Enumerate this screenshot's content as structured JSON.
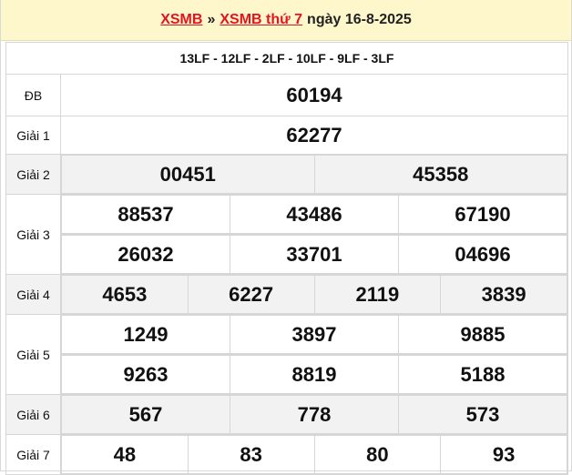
{
  "header": {
    "link1": "XSMB",
    "separator": "»",
    "link2": "XSMB thứ 7",
    "date_text": "ngày 16-8-2025"
  },
  "codes": "13LF - 12LF - 2LF - 10LF - 9LF - 3LF",
  "prizes": {
    "db": {
      "label": "ĐB",
      "values": [
        "60194"
      ]
    },
    "g1": {
      "label": "Giải 1",
      "values": [
        "62277"
      ]
    },
    "g2": {
      "label": "Giải 2",
      "values": [
        "00451",
        "45358"
      ]
    },
    "g3": {
      "label": "Giải 3",
      "values": [
        "88537",
        "43486",
        "67190",
        "26032",
        "33701",
        "04696"
      ]
    },
    "g4": {
      "label": "Giải 4",
      "values": [
        "4653",
        "6227",
        "2119",
        "3839"
      ]
    },
    "g5": {
      "label": "Giải 5",
      "values": [
        "1249",
        "3897",
        "9885",
        "9263",
        "8819",
        "5188"
      ]
    },
    "g6": {
      "label": "Giải 6",
      "values": [
        "567",
        "778",
        "573"
      ]
    },
    "g7": {
      "label": "Giải 7",
      "values": [
        "48",
        "83",
        "80",
        "93"
      ]
    }
  },
  "colors": {
    "header_bg": "#fff7cc",
    "accent_red": "#e4141e",
    "code_blue": "#1f6fb5",
    "row_shade": "#f2f2f2"
  }
}
